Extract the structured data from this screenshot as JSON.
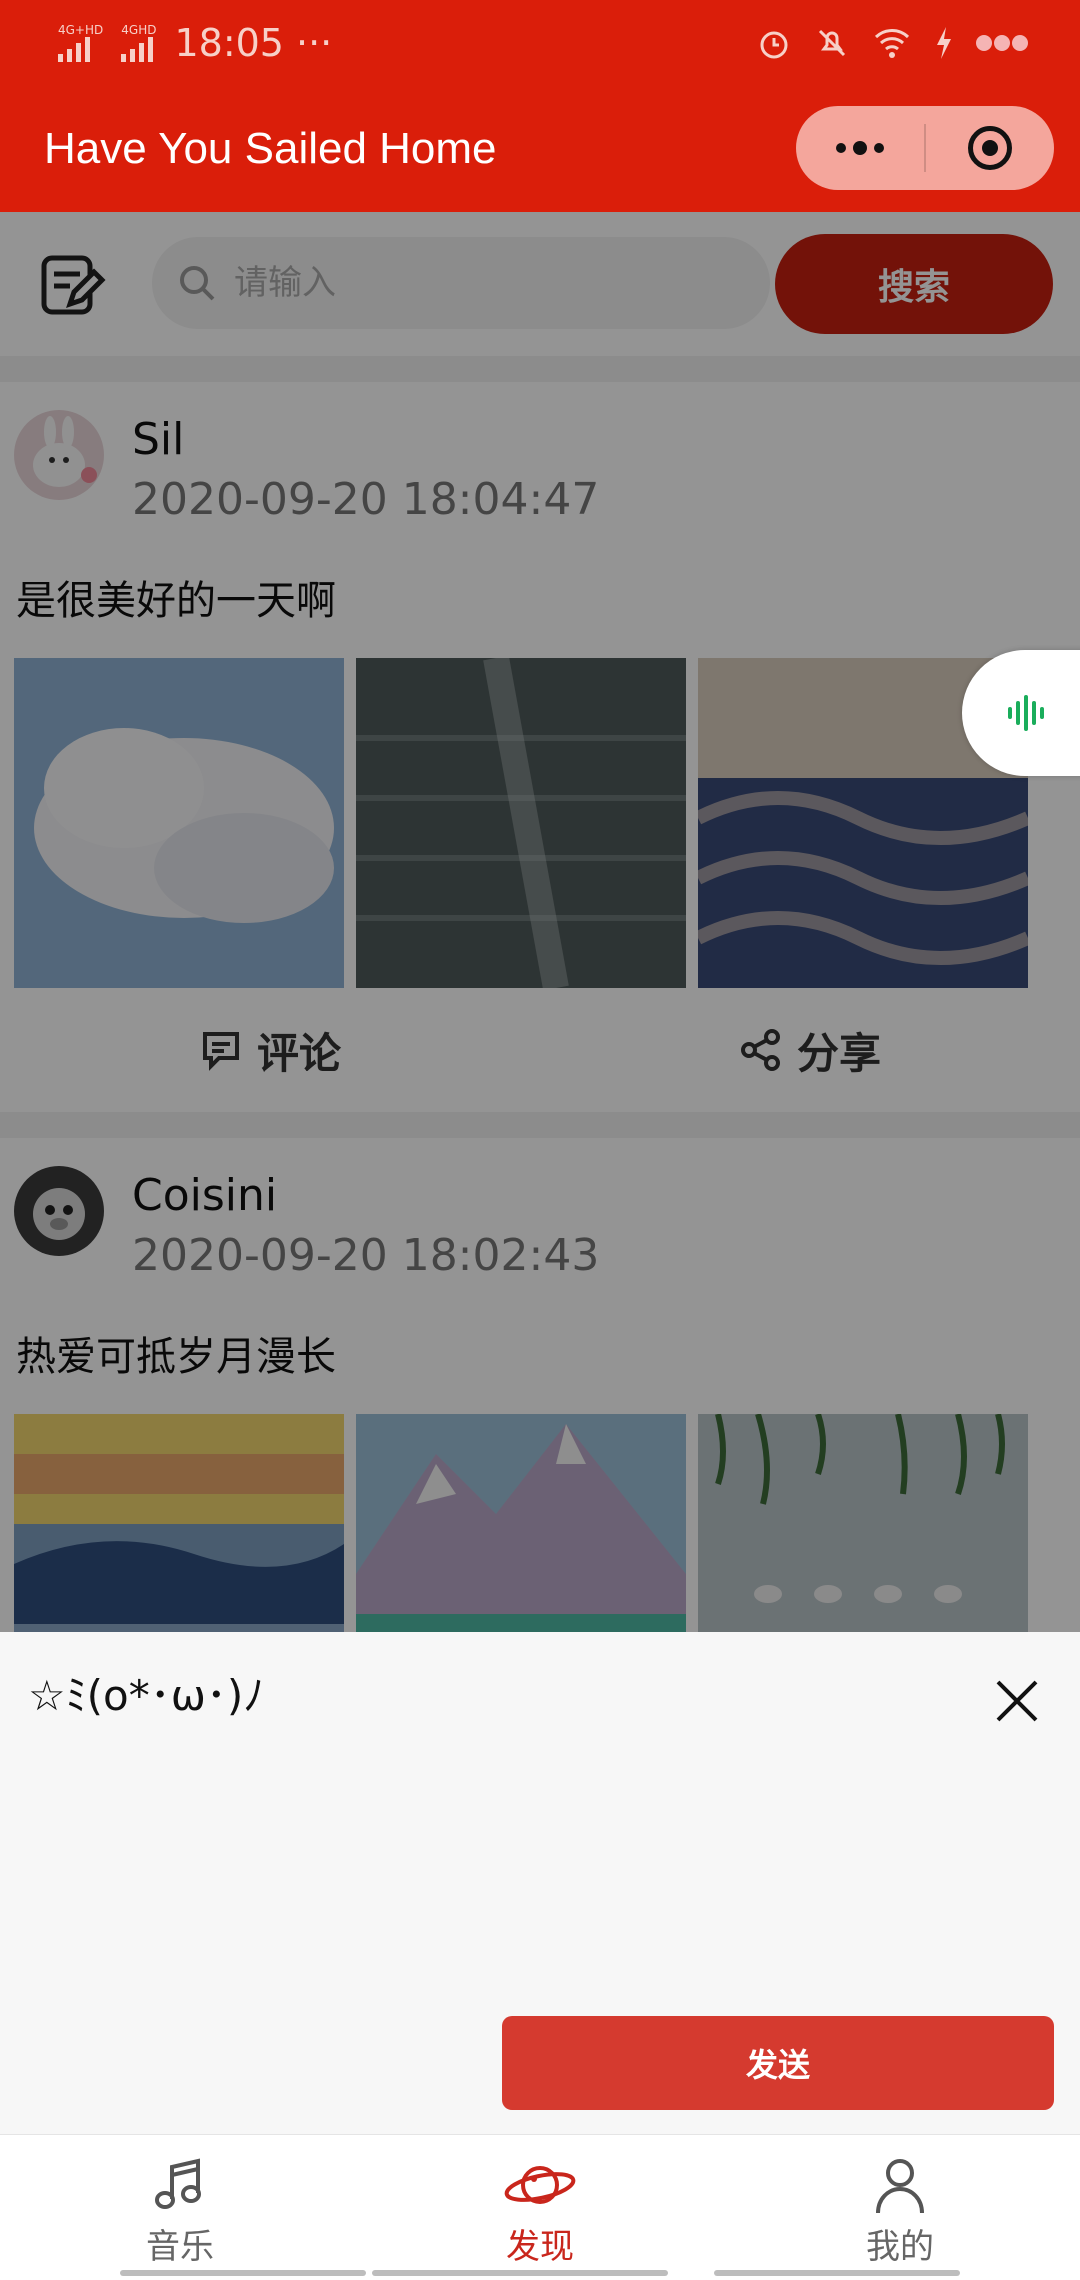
{
  "status_bar": {
    "network_1": "4G+HD",
    "network_2": "4GHD",
    "time": "18:05",
    "more": "···"
  },
  "header": {
    "title": "Have You Sailed Home",
    "capsule_more_icon": "more-dots-icon",
    "capsule_close_icon": "target-icon"
  },
  "search": {
    "placeholder": "请输入",
    "button_label": "搜索"
  },
  "posts": [
    {
      "user": "Sil",
      "time": "2020-09-20 18:04:47",
      "text": "是很美好的一天啊",
      "comment_label": "评论",
      "share_label": "分享"
    },
    {
      "user": "Coisini",
      "time": "2020-09-20 18:02:43",
      "text": "热爱可抵岁月漫长"
    }
  ],
  "comment_sheet": {
    "input_text": "☆ﾐ(o*･ω･)ﾉ",
    "send_label": "发送"
  },
  "tabbar": {
    "items": [
      {
        "label": "音乐",
        "icon": "music-note-icon",
        "active": false
      },
      {
        "label": "发现",
        "icon": "planet-icon",
        "active": true
      },
      {
        "label": "我的",
        "icon": "user-icon",
        "active": false
      }
    ]
  },
  "colors": {
    "brand_red": "#DA1E0A",
    "send_red": "#D53A2F",
    "tab_active": "#C9261C",
    "voice_green": "#1AAD5B"
  }
}
